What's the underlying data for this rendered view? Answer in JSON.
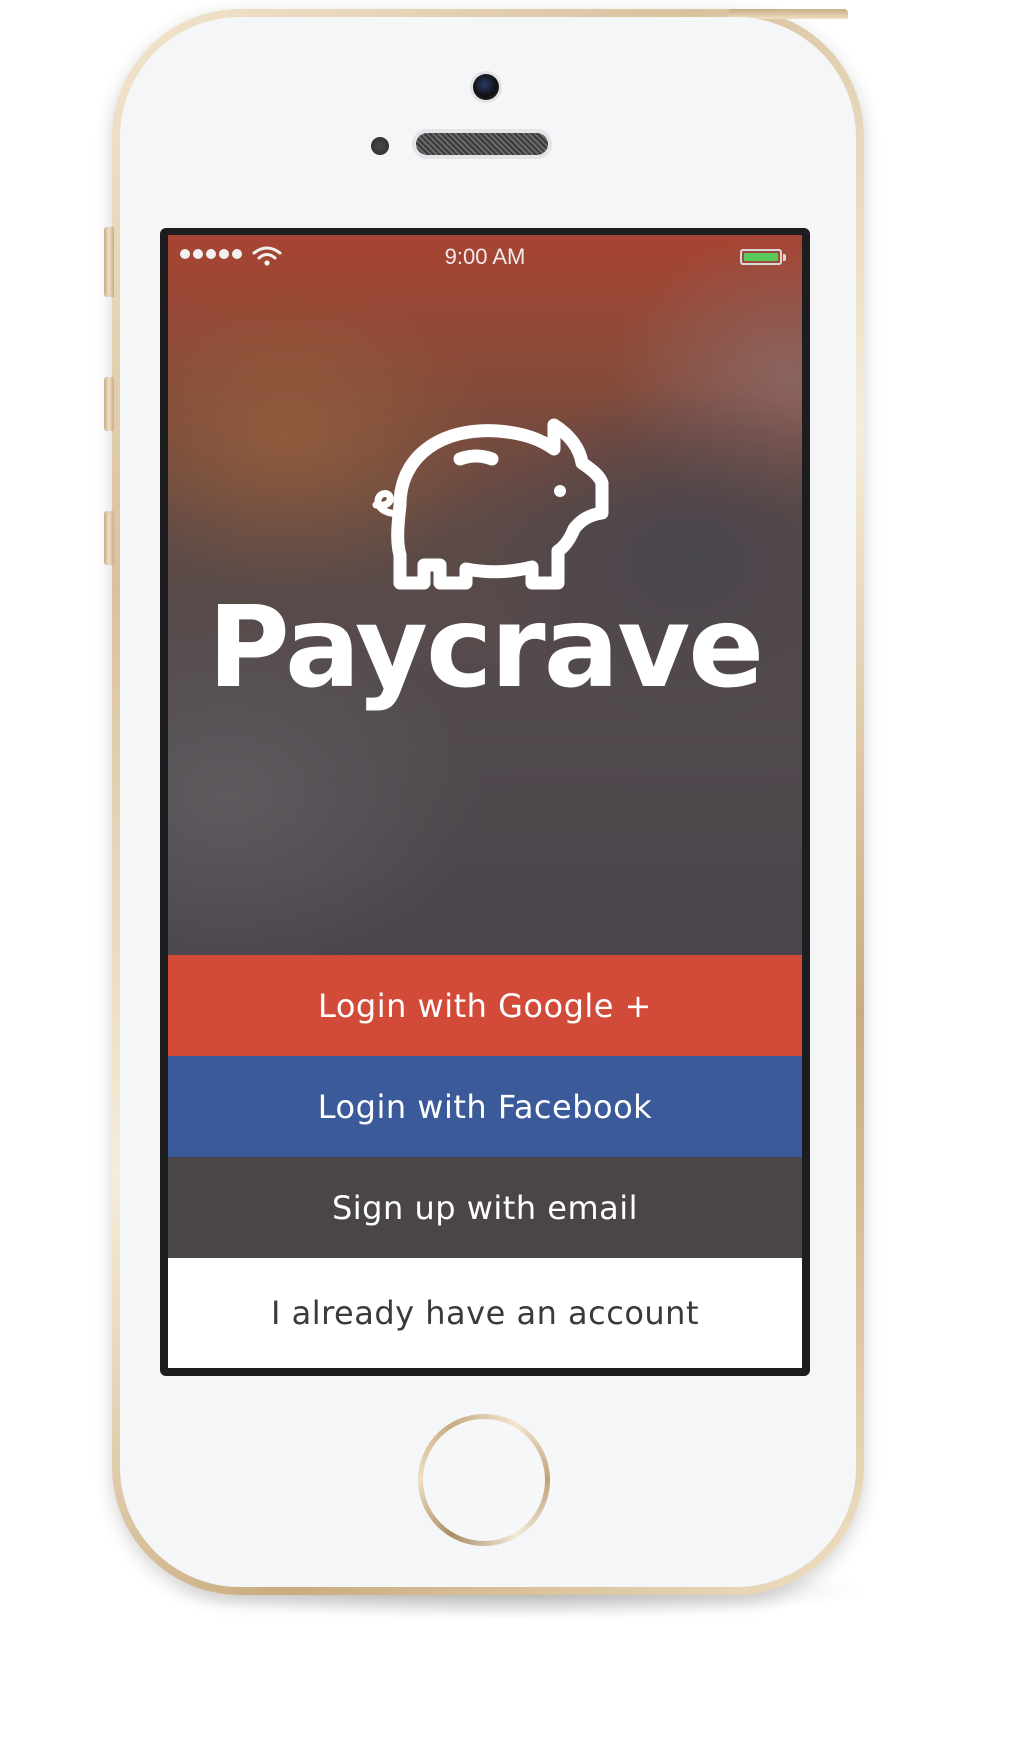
{
  "status_bar": {
    "time": "9:00 AM",
    "signal_bars": 5,
    "battery_color": "#59c95b"
  },
  "app": {
    "name": "Paycrave",
    "logo_icon": "piggy-bank-icon"
  },
  "buttons": {
    "google_label": "Login with Google +",
    "facebook_label": "Login with Facebook",
    "email_label": "Sign up with email",
    "account_label": "I already have an account"
  },
  "colors": {
    "google": "#d24a38",
    "facebook": "#3b5a9a",
    "email": "#4a4549",
    "account": "#ffffff"
  }
}
